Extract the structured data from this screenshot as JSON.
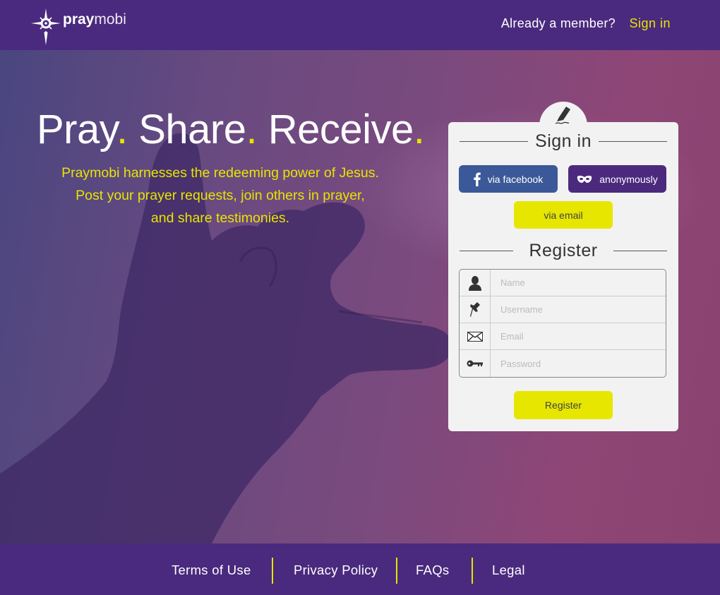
{
  "header": {
    "logo_bold": "pray",
    "logo_light": "mobi",
    "member_text": "Already a member?",
    "signin_link": "Sign in"
  },
  "hero": {
    "tagline": [
      "Pray",
      "Share",
      "Receive"
    ],
    "tagline_dot": ".",
    "subtext": [
      "Praymobi harnesses the redeeming power of Jesus.",
      "Post your prayer requests, join others in prayer,",
      "and share testimonies."
    ]
  },
  "card": {
    "signin_heading": "Sign in",
    "facebook_label": "via facebook",
    "anonymous_label": "anonymously",
    "email_label": "via email",
    "register_heading": "Register",
    "fields": {
      "name_placeholder": "Name",
      "username_placeholder": "Username",
      "email_placeholder": "Email",
      "password_placeholder": "Password"
    },
    "register_button": "Register"
  },
  "footer": {
    "links": [
      "Terms of Use",
      "Privacy Policy",
      "FAQs",
      "Legal"
    ]
  },
  "colors": {
    "brand_purple": "#4a2a7e",
    "accent_yellow": "#e8e400",
    "facebook_blue": "#3b5998"
  }
}
